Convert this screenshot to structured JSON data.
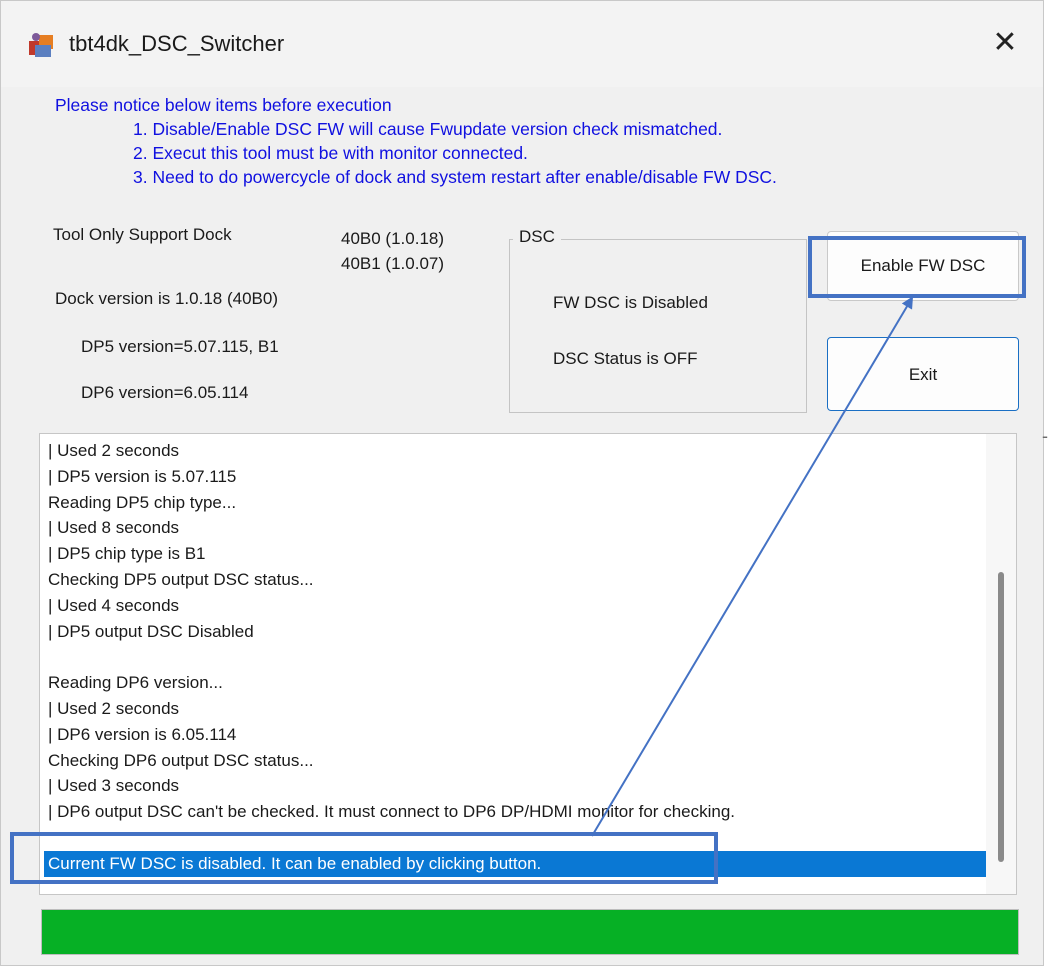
{
  "window": {
    "title": "tbt4dk_DSC_Switcher",
    "close_symbol": "✕"
  },
  "notice": {
    "header": "Please notice below items before execution",
    "items": [
      "1. Disable/Enable DSC FW will cause Fwupdate version check mismatched.",
      "2. Execut this tool must be with monitor connected.",
      "3. Need to do powercycle of dock and system restart after enable/disable FW DSC."
    ]
  },
  "info": {
    "support_label": "Tool Only Support Dock",
    "supported_docks": [
      "40B0 (1.0.18)",
      "40B1 (1.0.07)"
    ],
    "dock_version": "Dock version is 1.0.18 (40B0)",
    "dp5_version": "DP5 version=5.07.115, B1",
    "dp6_version": "DP6 version=6.05.114"
  },
  "dsc": {
    "group_title": "DSC",
    "fw_status": "FW DSC is Disabled",
    "dsc_status": "DSC Status is OFF"
  },
  "buttons": {
    "enable": "Enable FW DSC",
    "exit": "Exit"
  },
  "log": {
    "lines": [
      "|   Used 2 seconds",
      "|   DP5 version is 5.07.115",
      "Reading DP5 chip type...",
      "|   Used 8 seconds",
      "|   DP5 chip type is B1",
      "Checking DP5 output DSC status...",
      "|   Used 4 seconds",
      "|   DP5 output DSC Disabled",
      "",
      "Reading DP6 version...",
      "|   Used 2 seconds",
      "|   DP6 version is 6.05.114",
      "Checking DP6 output DSC status...",
      "|   Used 3 seconds",
      "|   DP6 output DSC can't be checked. It must connect to DP6 DP/HDMI monitor for checking.",
      "",
      "Current FW DSC is disabled. It can be enabled by clicking button."
    ],
    "selected_index": 16
  },
  "progress": {
    "percent": 100,
    "color": "#06b025"
  },
  "annotation": {
    "color": "#4472c4",
    "arrow_icon": "arrow-icon"
  },
  "colors": {
    "notice_text": "#1010e0",
    "selection": "#0a78d4"
  }
}
